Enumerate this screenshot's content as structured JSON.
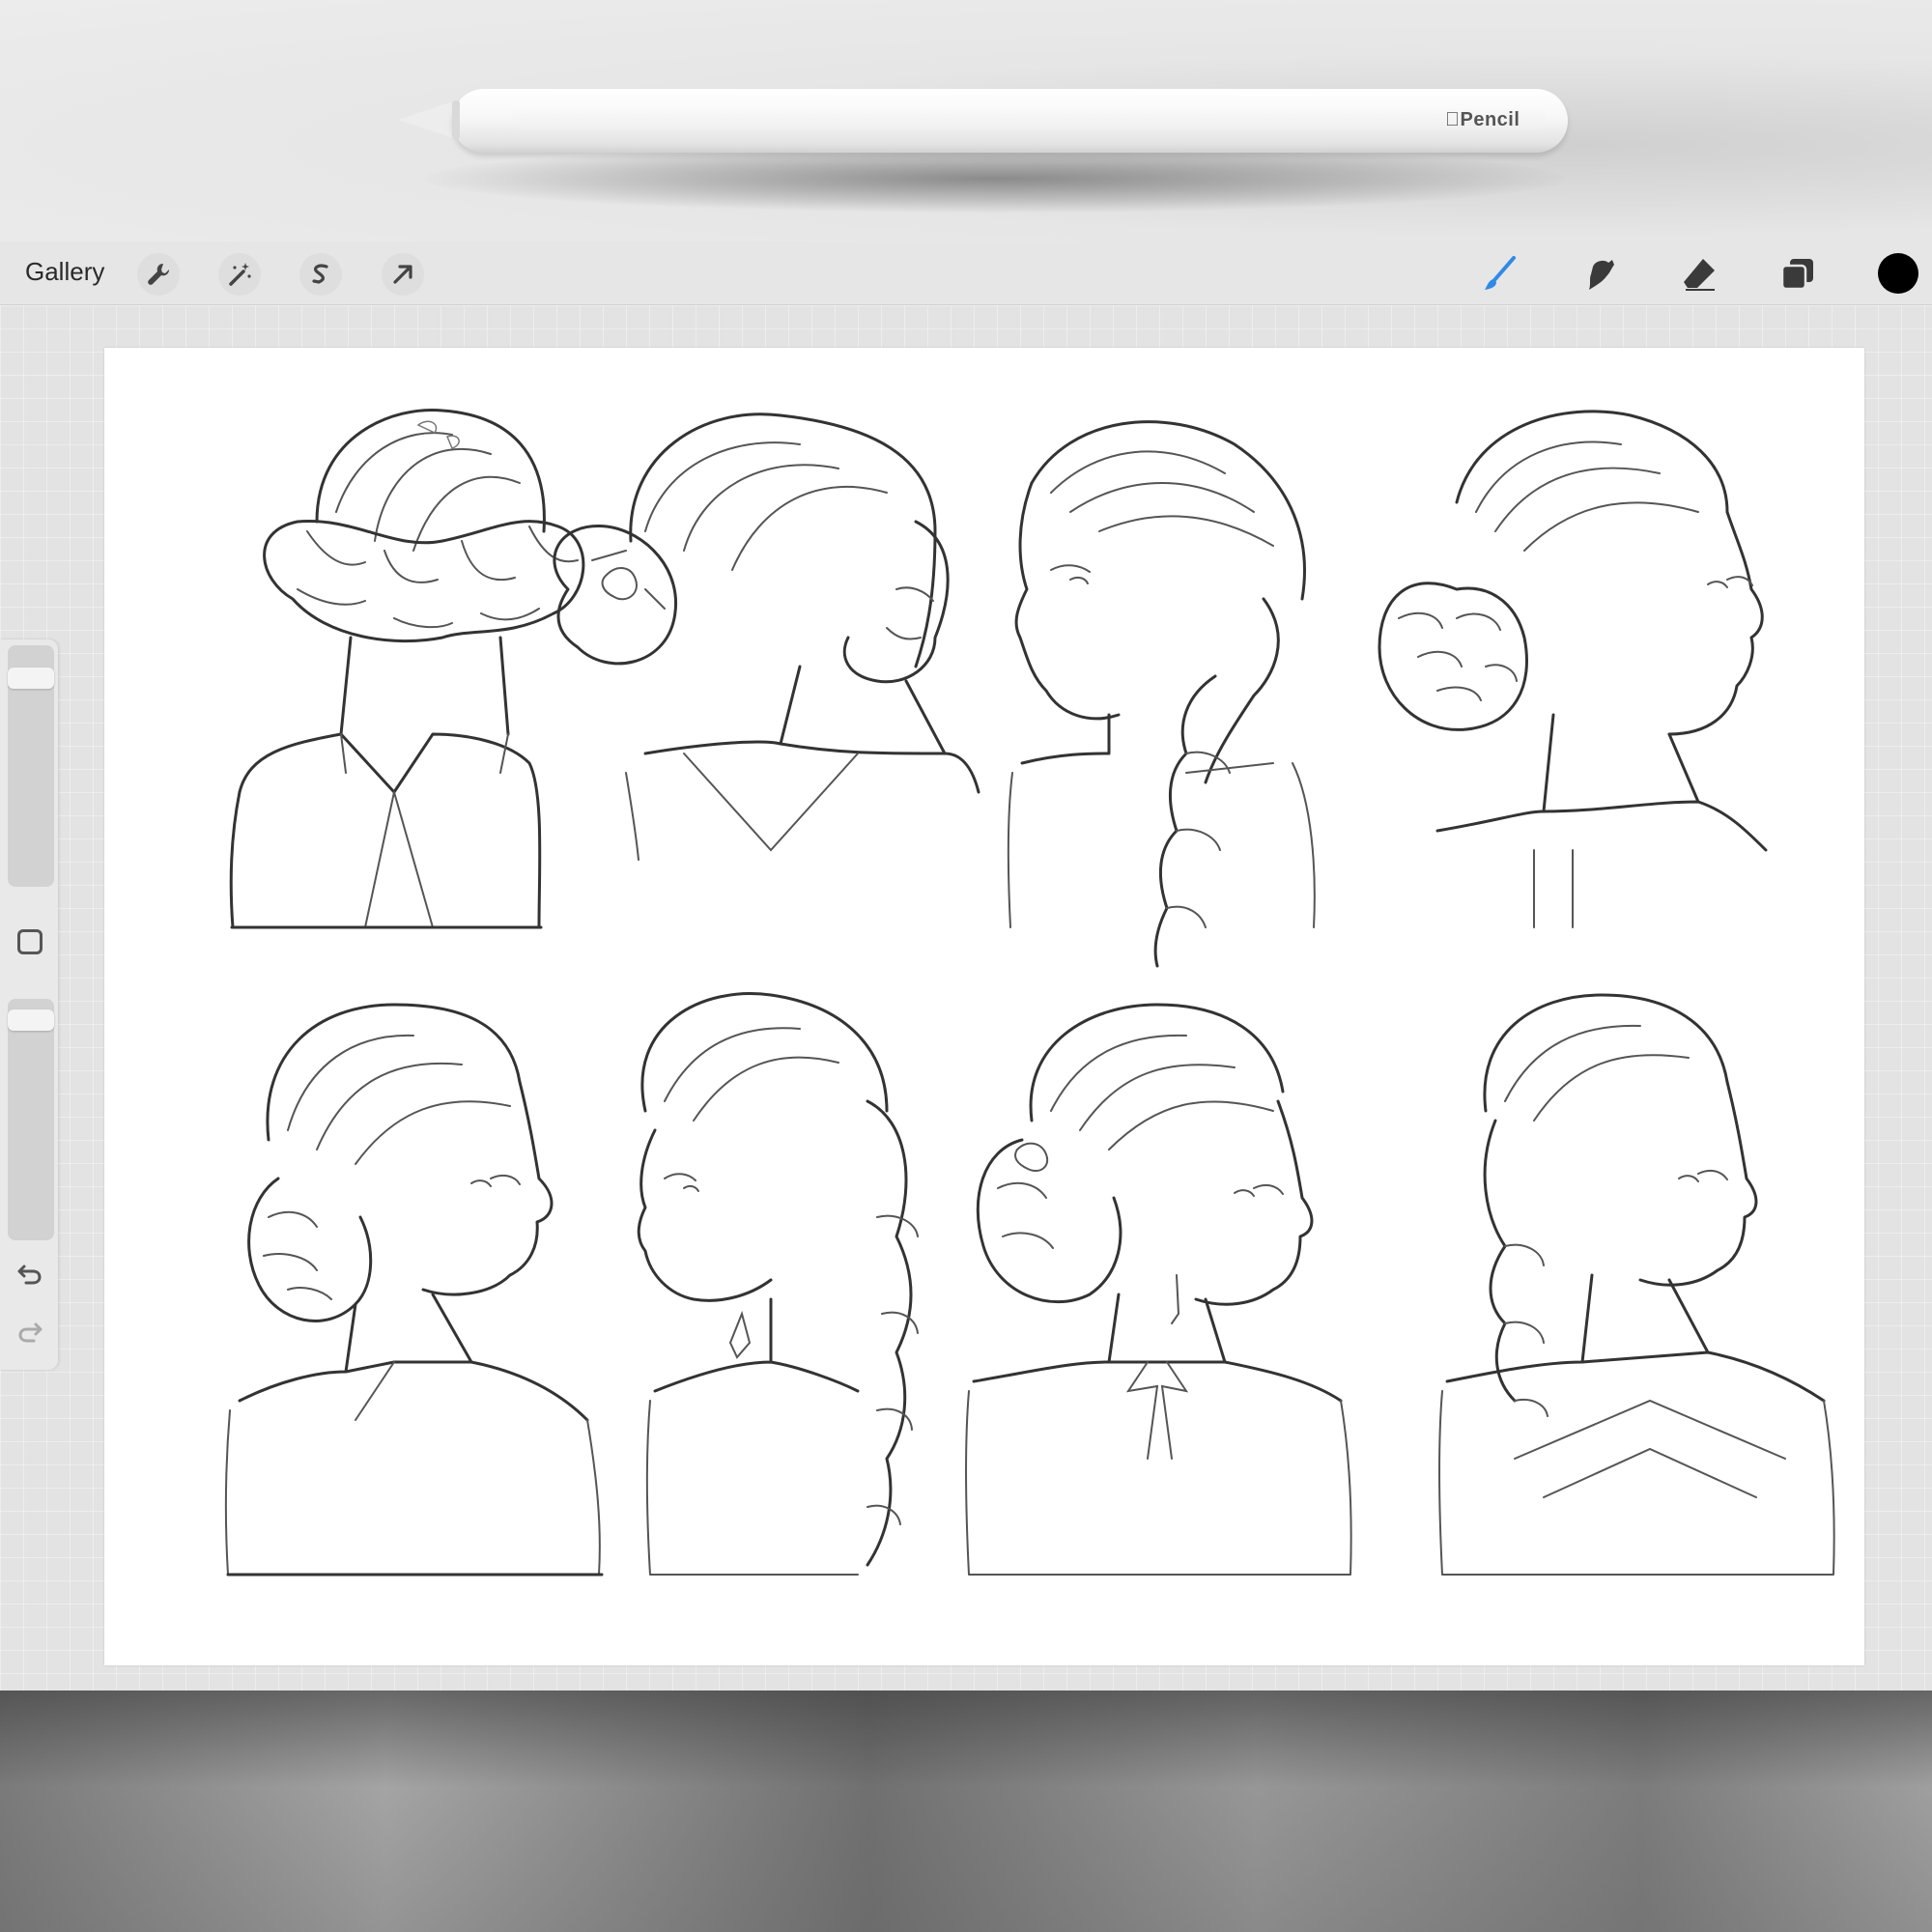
{
  "device": {
    "pencil_brand": "Pencil"
  },
  "toolbar": {
    "gallery_label": "Gallery",
    "left_tools": [
      {
        "name": "actions",
        "icon": "wrench-icon"
      },
      {
        "name": "adjustments",
        "icon": "magic-wand-icon"
      },
      {
        "name": "selection",
        "icon": "selection-s-icon"
      },
      {
        "name": "transform",
        "icon": "arrow-cursor-icon"
      }
    ],
    "right_tools": [
      {
        "name": "brush",
        "icon": "brush-icon",
        "active": true
      },
      {
        "name": "smudge",
        "icon": "smudge-icon",
        "active": false
      },
      {
        "name": "eraser",
        "icon": "eraser-icon",
        "active": false
      },
      {
        "name": "layers",
        "icon": "layers-icon",
        "active": false
      }
    ],
    "current_color": "#000000",
    "accent_color": "#2f8ae6"
  },
  "sidebar": {
    "brush_size_level": 0.9,
    "brush_opacity_level": 0.95,
    "modify_icon": "square-icon",
    "undo_icon": "undo-icon",
    "redo_icon": "redo-icon"
  },
  "canvas": {
    "content": "hairstyle-sketches",
    "grid_columns": 4,
    "grid_rows": 2,
    "figures": [
      {
        "view": "back",
        "style": "crown-braid"
      },
      {
        "view": "three-quarter",
        "style": "flower-bun"
      },
      {
        "view": "profile-left",
        "style": "side-braid"
      },
      {
        "view": "profile-right",
        "style": "braided-bun"
      },
      {
        "view": "three-quarter",
        "style": "low-bun"
      },
      {
        "view": "three-quarter",
        "style": "long-braid"
      },
      {
        "view": "three-quarter",
        "style": "flower-updo"
      },
      {
        "view": "three-quarter",
        "style": "knotted-ponytail"
      }
    ]
  }
}
